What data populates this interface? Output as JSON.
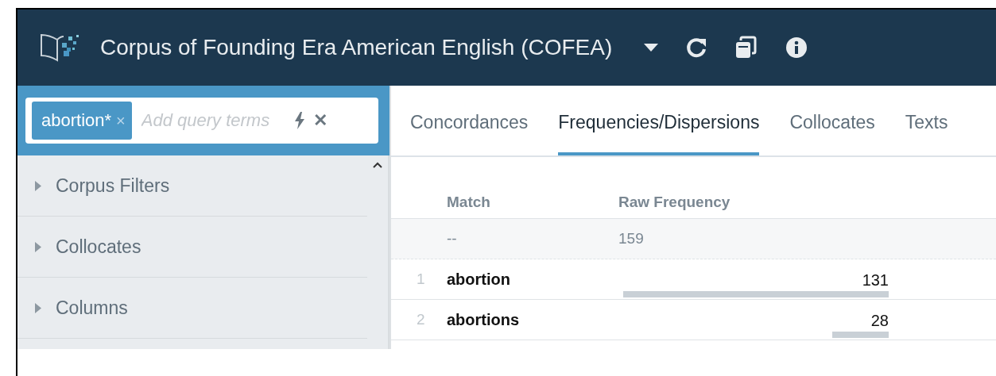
{
  "header": {
    "title": "Corpus of Founding Era American English (COFEA)"
  },
  "query": {
    "tokens": [
      {
        "label": "abortion*",
        "remove": "×"
      }
    ],
    "placeholder": "Add query terms",
    "clear": "✕"
  },
  "sidebar": {
    "items": [
      {
        "label": "Corpus Filters",
        "expanded": false
      },
      {
        "label": "Collocates",
        "expanded": false
      },
      {
        "label": "Columns",
        "expanded": false
      }
    ]
  },
  "tabs": [
    {
      "label": "Concordances",
      "selected": false
    },
    {
      "label": "Frequencies/Dispersions",
      "selected": true
    },
    {
      "label": "Collocates",
      "selected": false
    },
    {
      "label": "Texts",
      "selected": false
    }
  ],
  "table": {
    "columns": [
      "Match",
      "Raw Frequency"
    ],
    "total": {
      "match": "--",
      "frequency": "159"
    },
    "rows": [
      {
        "index": "1",
        "match": "abortion",
        "frequency": "131"
      },
      {
        "index": "2",
        "match": "abortions",
        "frequency": "28"
      }
    ]
  }
}
